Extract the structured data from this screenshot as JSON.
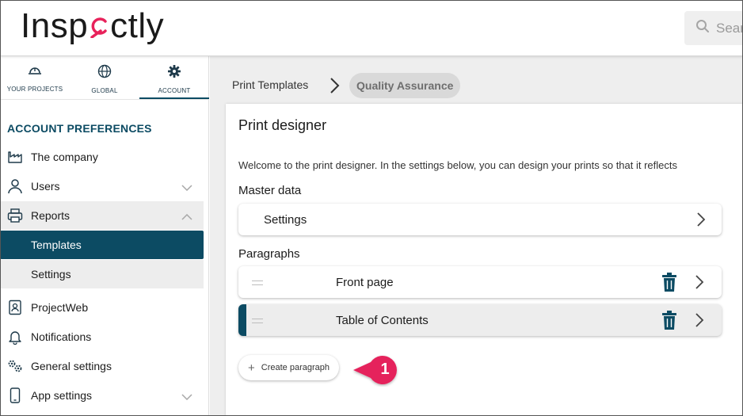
{
  "header": {
    "logo": {
      "prefix": "Insp",
      "suffix": "ctly"
    },
    "search": {
      "placeholder": "Sear"
    }
  },
  "sidebar": {
    "tabs": [
      {
        "label": "YOUR PROJECTS",
        "icon": "hard-hat-icon"
      },
      {
        "label": "GLOBAL",
        "icon": "globe-icon"
      },
      {
        "label": "ACCOUNT",
        "icon": "gear-icon",
        "active": true
      }
    ],
    "section_title": "ACCOUNT PREFERENCES",
    "items": [
      {
        "label": "The company",
        "icon": "factory-icon"
      },
      {
        "label": "Users",
        "icon": "user-icon",
        "expandable": true
      },
      {
        "label": "Reports",
        "icon": "printer-icon",
        "expandable": true,
        "expanded": true,
        "children": [
          {
            "label": "Templates",
            "active": true
          },
          {
            "label": "Settings"
          }
        ]
      },
      {
        "label": "ProjectWeb",
        "icon": "contact-card-icon"
      },
      {
        "label": "Notifications",
        "icon": "bell-icon"
      },
      {
        "label": "General settings",
        "icon": "gears-icon"
      },
      {
        "label": "App settings",
        "icon": "phone-icon",
        "expandable": true
      }
    ]
  },
  "breadcrumb": {
    "parent": "Print Templates",
    "current": "Quality Assurance"
  },
  "card": {
    "title": "Print designer",
    "description": "Welcome to the print designer. In the settings below, you can design your prints so that it reflects",
    "master_data": {
      "title": "Master data",
      "rows": [
        {
          "label": "Settings"
        }
      ]
    },
    "paragraphs": {
      "title": "Paragraphs",
      "rows": [
        {
          "label": "Front page",
          "selected": false
        },
        {
          "label": "Table of Contents",
          "selected": true
        }
      ]
    },
    "create_button": "Create paragraph"
  },
  "callout": {
    "number": "1"
  },
  "colors": {
    "primary": "#0c4b63",
    "accent": "#e8225b",
    "callout": "#e5245c",
    "background": "#eeeeee"
  }
}
